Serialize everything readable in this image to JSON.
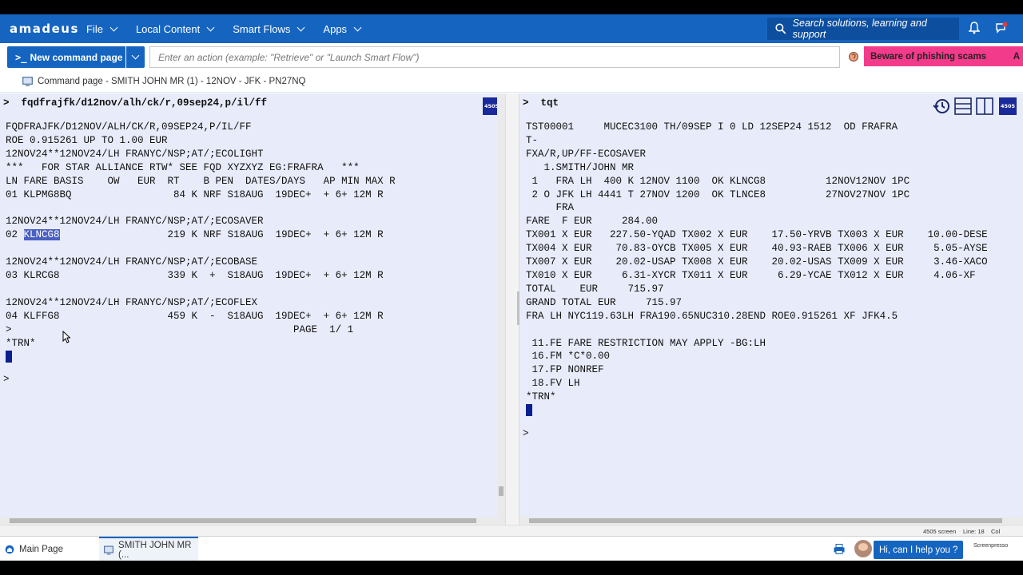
{
  "nav": {
    "logo": "amadeus",
    "items": [
      {
        "label": "File"
      },
      {
        "label": "Local Content"
      },
      {
        "label": "Smart Flows"
      },
      {
        "label": "Apps"
      }
    ],
    "search_placeholder": "Search solutions, learning and support"
  },
  "cmdbar": {
    "new_command_label": "New command page",
    "action_placeholder": "Enter an action (example: \"Retrieve\" or \"Launch Smart Flow\")",
    "phishing_label": "Beware of phishing scams",
    "phishing_more": "A"
  },
  "breadcrumb": {
    "label": "Command page - SMITH JOHN MR (1) - 12NOV - JFK - PN27NQ"
  },
  "left_pane": {
    "command": ">  fqdfrajfk/d12nov/alh/ck/r,09sep24,p/il/ff",
    "badge": "4505",
    "lines_a": "FQDFRAJFK/D12NOV/ALH/CK/R,09SEP24,P/IL/FF\nROE 0.915261 UP TO 1.00 EUR\n12NOV24**12NOV24/LH FRANYC/NSP;AT/;ECOLIGHT\n***   FOR STAR ALLIANCE RTW* SEE FQD XYZXYZ EG:FRAFRA   ***\nLN FARE BASIS    OW   EUR  RT    B PEN  DATES/DAYS   AP MIN MAX R\n01 KLPMG8BQ                 84 K NRF S18AUG  19DEC+  + 6+ 12M R\n\n12NOV24**12NOV24/LH FRANYC/NSP;AT/;ECOSAVER",
    "row02_prefix": "02 ",
    "row02_highlight": "KLNCG8",
    "row02_rest": "                  219 K NRF S18AUG  19DEC+  + 6+ 12M R",
    "lines_b": "\n12NOV24**12NOV24/LH FRANYC/NSP;AT/;ECOBASE\n03 KLRCG8                  339 K  +  S18AUG  19DEC+  + 6+ 12M R\n\n12NOV24**12NOV24/LH FRANYC/NSP;AT/;ECOFLEX\n04 KLFFG8                  459 K  -  S18AUG  19DEC+  + 6+ 12M R\n>                                               PAGE  1/ 1\n*TRN*",
    "end_prompt": ">"
  },
  "right_pane": {
    "command": ">  tqt",
    "badge": "4505",
    "lines": "TST00001     MUCEC3100 TH/09SEP I 0 LD 12SEP24 1512  OD FRAFRA\nT-\nFXA/R,UP/FF-ECOSAVER\n   1.SMITH/JOHN MR\n 1   FRA LH  400 K 12NOV 1100  OK KLNCG8          12NOV12NOV 1PC\n 2 O JFK LH 4441 T 27NOV 1200  OK TLNCE8          27NOV27NOV 1PC\n     FRA\nFARE  F EUR     284.00\nTX001 X EUR   227.50-YQAD TX002 X EUR    17.50-YRVB TX003 X EUR    10.00-DESE\nTX004 X EUR    70.83-OYCB TX005 X EUR    40.93-RAEB TX006 X EUR     5.05-AYSE\nTX007 X EUR    20.02-USAP TX008 X EUR    20.02-USAS TX009 X EUR     3.46-XACO\nTX010 X EUR     6.31-XYCR TX011 X EUR     6.29-YCAE TX012 X EUR     4.06-XF\nTOTAL    EUR     715.97\nGRAND TOTAL EUR     715.97\nFRA LH NYC119.63LH FRA190.65NUC310.28END ROE0.915261 XF JFK4.5\n\n 11.FE FARE RESTRICTION MAY APPLY -BG:LH\n 16.FM *C*0.00\n 17.FP NONREF\n 18.FV LH\n*TRN*",
    "end_prompt": ">"
  },
  "status": {
    "screen": "4505 screen",
    "line": "Line: 18",
    "col": "Col"
  },
  "taskbar": {
    "main_page": "Main Page",
    "active_tab": "SMITH JOHN MR (...",
    "help": "Hi, can I help you ?",
    "screenpresso": "Screenpresso"
  },
  "colors": {
    "brand_blue": "#1565c0",
    "terminal_bg": "#e8ecfa",
    "phishing_pink": "#f33b8c"
  }
}
